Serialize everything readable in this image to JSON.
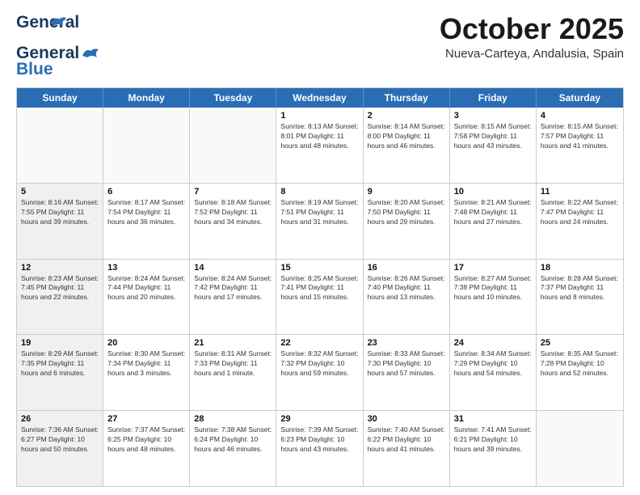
{
  "header": {
    "logo_line1": "General",
    "logo_line2": "Blue",
    "month_title": "October 2025",
    "subtitle": "Nueva-Carteya, Andalusia, Spain"
  },
  "weekdays": [
    "Sunday",
    "Monday",
    "Tuesday",
    "Wednesday",
    "Thursday",
    "Friday",
    "Saturday"
  ],
  "rows": [
    [
      {
        "date": "",
        "info": "",
        "empty": true
      },
      {
        "date": "",
        "info": "",
        "empty": true
      },
      {
        "date": "",
        "info": "",
        "empty": true
      },
      {
        "date": "1",
        "info": "Sunrise: 8:13 AM\nSunset: 8:01 PM\nDaylight: 11 hours\nand 48 minutes."
      },
      {
        "date": "2",
        "info": "Sunrise: 8:14 AM\nSunset: 8:00 PM\nDaylight: 11 hours\nand 46 minutes."
      },
      {
        "date": "3",
        "info": "Sunrise: 8:15 AM\nSunset: 7:58 PM\nDaylight: 11 hours\nand 43 minutes."
      },
      {
        "date": "4",
        "info": "Sunrise: 8:15 AM\nSunset: 7:57 PM\nDaylight: 11 hours\nand 41 minutes."
      }
    ],
    [
      {
        "date": "5",
        "info": "Sunrise: 8:16 AM\nSunset: 7:55 PM\nDaylight: 11 hours\nand 39 minutes.",
        "shaded": true
      },
      {
        "date": "6",
        "info": "Sunrise: 8:17 AM\nSunset: 7:54 PM\nDaylight: 11 hours\nand 36 minutes."
      },
      {
        "date": "7",
        "info": "Sunrise: 8:18 AM\nSunset: 7:52 PM\nDaylight: 11 hours\nand 34 minutes."
      },
      {
        "date": "8",
        "info": "Sunrise: 8:19 AM\nSunset: 7:51 PM\nDaylight: 11 hours\nand 31 minutes."
      },
      {
        "date": "9",
        "info": "Sunrise: 8:20 AM\nSunset: 7:50 PM\nDaylight: 11 hours\nand 29 minutes."
      },
      {
        "date": "10",
        "info": "Sunrise: 8:21 AM\nSunset: 7:48 PM\nDaylight: 11 hours\nand 27 minutes."
      },
      {
        "date": "11",
        "info": "Sunrise: 8:22 AM\nSunset: 7:47 PM\nDaylight: 11 hours\nand 24 minutes."
      }
    ],
    [
      {
        "date": "12",
        "info": "Sunrise: 8:23 AM\nSunset: 7:45 PM\nDaylight: 11 hours\nand 22 minutes.",
        "shaded": true
      },
      {
        "date": "13",
        "info": "Sunrise: 8:24 AM\nSunset: 7:44 PM\nDaylight: 11 hours\nand 20 minutes."
      },
      {
        "date": "14",
        "info": "Sunrise: 8:24 AM\nSunset: 7:42 PM\nDaylight: 11 hours\nand 17 minutes."
      },
      {
        "date": "15",
        "info": "Sunrise: 8:25 AM\nSunset: 7:41 PM\nDaylight: 11 hours\nand 15 minutes."
      },
      {
        "date": "16",
        "info": "Sunrise: 8:26 AM\nSunset: 7:40 PM\nDaylight: 11 hours\nand 13 minutes."
      },
      {
        "date": "17",
        "info": "Sunrise: 8:27 AM\nSunset: 7:38 PM\nDaylight: 11 hours\nand 10 minutes."
      },
      {
        "date": "18",
        "info": "Sunrise: 8:28 AM\nSunset: 7:37 PM\nDaylight: 11 hours\nand 8 minutes."
      }
    ],
    [
      {
        "date": "19",
        "info": "Sunrise: 8:29 AM\nSunset: 7:35 PM\nDaylight: 11 hours\nand 6 minutes.",
        "shaded": true
      },
      {
        "date": "20",
        "info": "Sunrise: 8:30 AM\nSunset: 7:34 PM\nDaylight: 11 hours\nand 3 minutes."
      },
      {
        "date": "21",
        "info": "Sunrise: 8:31 AM\nSunset: 7:33 PM\nDaylight: 11 hours\nand 1 minute."
      },
      {
        "date": "22",
        "info": "Sunrise: 8:32 AM\nSunset: 7:32 PM\nDaylight: 10 hours\nand 59 minutes."
      },
      {
        "date": "23",
        "info": "Sunrise: 8:33 AM\nSunset: 7:30 PM\nDaylight: 10 hours\nand 57 minutes."
      },
      {
        "date": "24",
        "info": "Sunrise: 8:34 AM\nSunset: 7:29 PM\nDaylight: 10 hours\nand 54 minutes."
      },
      {
        "date": "25",
        "info": "Sunrise: 8:35 AM\nSunset: 7:28 PM\nDaylight: 10 hours\nand 52 minutes."
      }
    ],
    [
      {
        "date": "26",
        "info": "Sunrise: 7:36 AM\nSunset: 6:27 PM\nDaylight: 10 hours\nand 50 minutes.",
        "shaded": true
      },
      {
        "date": "27",
        "info": "Sunrise: 7:37 AM\nSunset: 6:25 PM\nDaylight: 10 hours\nand 48 minutes."
      },
      {
        "date": "28",
        "info": "Sunrise: 7:38 AM\nSunset: 6:24 PM\nDaylight: 10 hours\nand 46 minutes."
      },
      {
        "date": "29",
        "info": "Sunrise: 7:39 AM\nSunset: 6:23 PM\nDaylight: 10 hours\nand 43 minutes."
      },
      {
        "date": "30",
        "info": "Sunrise: 7:40 AM\nSunset: 6:22 PM\nDaylight: 10 hours\nand 41 minutes."
      },
      {
        "date": "31",
        "info": "Sunrise: 7:41 AM\nSunset: 6:21 PM\nDaylight: 10 hours\nand 39 minutes."
      },
      {
        "date": "",
        "info": "",
        "empty": true
      }
    ]
  ]
}
